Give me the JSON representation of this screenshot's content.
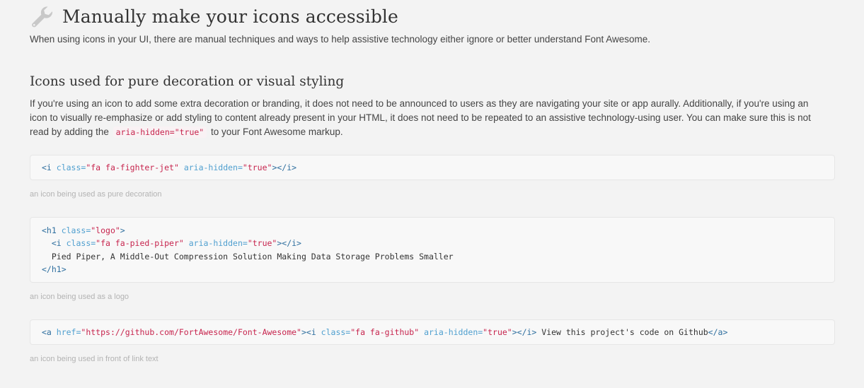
{
  "header": {
    "title": "Manually make your icons accessible",
    "icon": "wrench-icon",
    "icon_color": "#c8c8c8"
  },
  "lead": "When using icons in your UI, there are manual techniques and ways to help assistive technology either ignore or better understand Font Awesome.",
  "section": {
    "heading": "Icons used for pure decoration or visual styling",
    "para": {
      "line1": "If you're using an icon to add some extra decoration or branding, it does not need to be announced to users as they are navigating your site or app aurally. Additionally, if you're using an",
      "line2": "icon to visually re-emphasize or add styling to content already present in your HTML, it does not need to be repeated to an assistive technology-using user. You can make sure this is not",
      "line3_before": "read by adding the",
      "line3_code": "aria-hidden=\"true\"",
      "line3_after": "to your Font Awesome markup."
    }
  },
  "examples": [
    {
      "code": {
        "l1": {
          "t1": "<i ",
          "a1": "class=",
          "s1": "\"fa fa-fighter-jet\"",
          "a2": " aria-hidden=",
          "s2": "\"true\"",
          "t2": "></i>"
        }
      },
      "caption": "an icon being used as pure decoration"
    },
    {
      "code": {
        "l1": {
          "t1": "<h1 ",
          "a1": "class=",
          "s1": "\"logo\"",
          "t2": ">"
        },
        "l2": {
          "t1": "  <i ",
          "a1": "class=",
          "s1": "\"fa fa-pied-piper\"",
          "a2": " aria-hidden=",
          "s2": "\"true\"",
          "t2": "></i>"
        },
        "l3": {
          "txt": "  Pied Piper, A Middle-Out Compression Solution Making Data Storage Problems Smaller"
        },
        "l4": {
          "t1": "</h1>"
        }
      },
      "caption": "an icon being used as a logo"
    },
    {
      "code": {
        "l1": {
          "t1": "<a ",
          "a1": "href=",
          "s1": "\"https://github.com/FortAwesome/Font-Awesome\"",
          "t2": "><i ",
          "a2": "class=",
          "s2": "\"fa fa-github\"",
          "a3": " aria-hidden=",
          "s3": "\"true\"",
          "t3": "></i>",
          "txt": " View this project's code on Github",
          "t4": "</a>"
        }
      },
      "caption": "an icon being used in front of link text"
    }
  ]
}
